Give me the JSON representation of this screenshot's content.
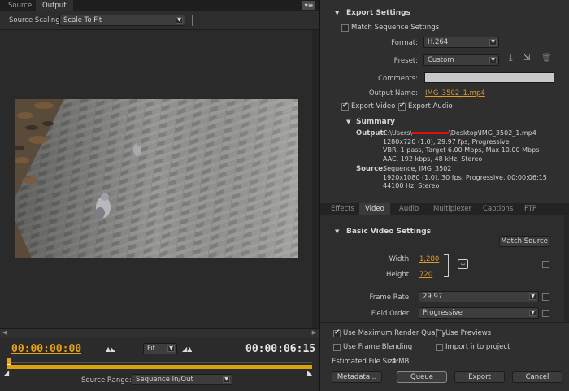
{
  "source_panel": {
    "tabs": [
      "Source",
      "Output"
    ],
    "panel_menu": "▾≡",
    "scaling_label": "Source Scaling:",
    "scaling_value": "Scale To Fit",
    "current_time": "00:00:00:00",
    "zoom_value": "Fit",
    "duration": "00:00:06:15",
    "source_range_label": "Source Range:",
    "source_range_value": "Sequence In/Out"
  },
  "export_settings": {
    "title": "Export Settings",
    "match_sequence_label": "Match Sequence Settings",
    "format_label": "Format:",
    "format_value": "H.264",
    "preset_label": "Preset:",
    "preset_value": "Custom",
    "comments_label": "Comments:",
    "comments_value": "",
    "output_name_label": "Output Name:",
    "output_name_value": "IMG_3502_1.mp4",
    "export_video_label": "Export Video",
    "export_audio_label": "Export Audio"
  },
  "summary": {
    "title": "Summary",
    "output_label": "Output:",
    "output_path_prefix": "C:\\Users\\",
    "output_path_suffix": "\\Desktop\\IMG_3502_1.mp4",
    "output_lines": [
      "1280x720 (1.0), 29.97 fps, Progressive",
      "VBR, 1 pass, Target 6.00 Mbps, Max 10.00 Mbps",
      "AAC, 192 kbps, 48 kHz, Stereo"
    ],
    "source_label": "Source:",
    "source_lines": [
      "Sequence, IMG_3502",
      "1920x1080 (1.0), 30 fps, Progressive, 00:00:06:15",
      "44100 Hz, Stereo"
    ]
  },
  "tabs": [
    "Effects",
    "Video",
    "Audio",
    "Multiplexer",
    "Captions",
    "FTP"
  ],
  "basic_video": {
    "title": "Basic Video Settings",
    "match_source_label": "Match Source",
    "width_label": "Width:",
    "width_value": "1,280",
    "height_label": "Height:",
    "height_value": "720",
    "frame_rate_label": "Frame Rate:",
    "frame_rate_value": "29.97",
    "field_order_label": "Field Order:",
    "field_order_value": "Progressive"
  },
  "bottom": {
    "max_render_label": "Use Maximum Render Quality",
    "use_previews_label": "Use Previews",
    "frame_blending_label": "Use Frame Blending",
    "import_project_label": "Import into project",
    "file_size_label": "Estimated File Size:",
    "file_size_value": "4 MB",
    "metadata_label": "Metadata...",
    "queue_label": "Queue",
    "export_label": "Export",
    "cancel_label": "Cancel"
  },
  "colors": {
    "accent_orange": "#e8a21a",
    "panel_bg": "#2f2f2f",
    "redaction_red": "#e01010"
  }
}
